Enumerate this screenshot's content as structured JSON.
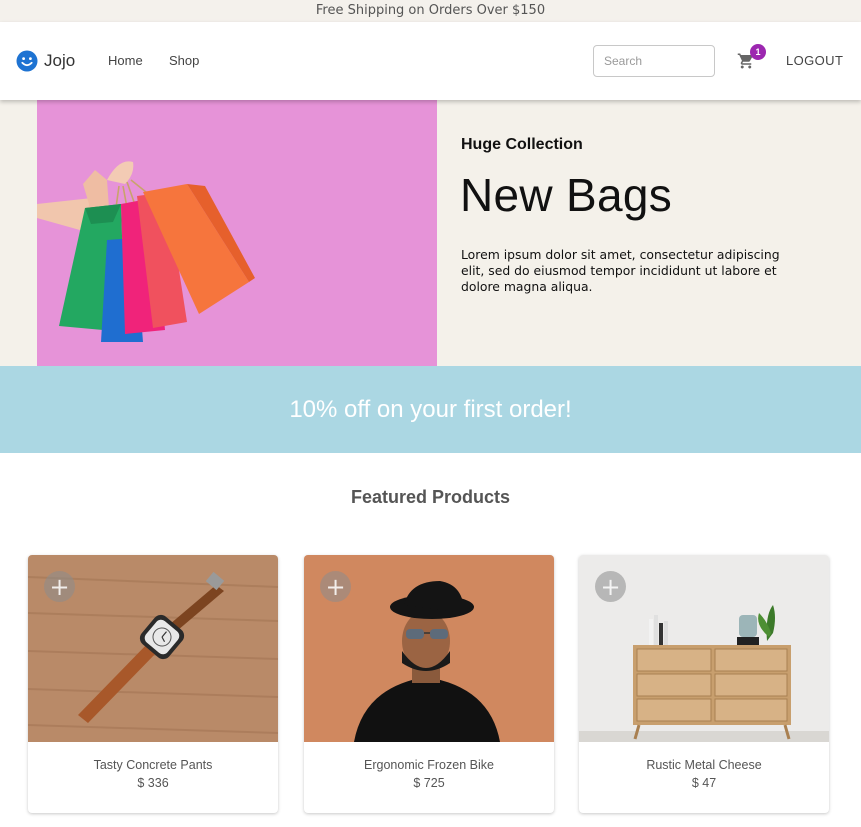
{
  "announcement": "Free Shipping on Orders Over $150",
  "brand": {
    "name": "Jojo",
    "icon": "smiley-face-icon",
    "color": "#1e73d2"
  },
  "nav": {
    "home": "Home",
    "shop": "Shop"
  },
  "search": {
    "placeholder": "Search",
    "value": ""
  },
  "cart": {
    "icon": "shopping-cart-icon",
    "count": "1",
    "badge_color": "#9c27b0"
  },
  "logout_label": "LOGOUT",
  "hero": {
    "eyebrow": "Huge Collection",
    "title": "New Bags",
    "text": "Lorem ipsum dolor sit amet, consectetur adipiscing elit, sed do eiusmod tempor incididunt ut labore et dolore magna aliqua.",
    "image_bg": "#e693d8"
  },
  "promo": {
    "text": "10% off on your first order!",
    "bg": "#abd7e3"
  },
  "featured": {
    "title": "Featured Products",
    "products": [
      {
        "name": "Tasty Concrete Pants",
        "price": "$ 336",
        "image": "watch-photo"
      },
      {
        "name": "Ergonomic Frozen Bike",
        "price": "$ 725",
        "image": "man-with-hat-photo"
      },
      {
        "name": "Rustic Metal Cheese",
        "price": "$ 47",
        "image": "wooden-dresser-photo"
      }
    ]
  }
}
